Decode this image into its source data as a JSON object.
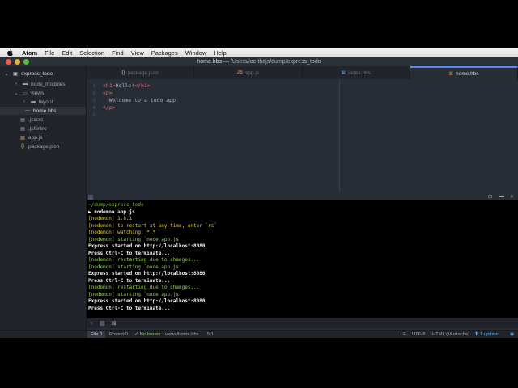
{
  "menubar": {
    "apple": "",
    "items": [
      "Atom",
      "File",
      "Edit",
      "Selection",
      "Find",
      "View",
      "Packages",
      "Window",
      "Help"
    ]
  },
  "window": {
    "title_doc": "home.hbs",
    "title_sep": " — ",
    "title_path": "/Users/ioc-thajs/dump/express_todo"
  },
  "tree": {
    "root": "express_todo",
    "items": [
      {
        "label": "node_modules",
        "icon": "folder-icon",
        "arrow": "›"
      },
      {
        "label": "views",
        "icon": "folder-icon",
        "arrow": "⌄"
      },
      {
        "label": "layout",
        "icon": "folder-icon",
        "arrow": "›"
      },
      {
        "label": "home.hbs",
        "icon": "file-icon"
      },
      {
        "label": ".jscsrc",
        "icon": "file-icon"
      },
      {
        "label": ".jshintrc",
        "icon": "file-icon"
      },
      {
        "label": "app.js",
        "icon": "js-icon"
      },
      {
        "label": "package.json",
        "icon": "json-icon"
      }
    ]
  },
  "tabs": [
    {
      "label": "package.json",
      "icon": "{}"
    },
    {
      "label": "app.js",
      "icon": "JS"
    },
    {
      "label": "index.hbs",
      "icon": "⌘"
    },
    {
      "label": "home.hbs",
      "icon": "⌘",
      "active": true
    }
  ],
  "editor": {
    "lines": [
      {
        "n": "1",
        "open": "<h1>",
        "text": "Hello!",
        "close": "</h1>"
      },
      {
        "n": "2",
        "open": "<p>",
        "text": "",
        "close": ""
      },
      {
        "n": "3",
        "open": "",
        "text": "  Welcome to a todo app",
        "close": ""
      },
      {
        "n": "4",
        "open": "</p>",
        "text": "",
        "close": ""
      },
      {
        "n": "5",
        "open": "",
        "text": "",
        "close": ""
      }
    ]
  },
  "terminal": {
    "lines": [
      {
        "text": "~/dump/express_todo",
        "color": "path"
      },
      {
        "text": "▶ nodemon app.js",
        "color": "white"
      },
      {
        "text": "[nodemon] 1.8.1",
        "color": "yellow"
      },
      {
        "text": "[nodemon] to restart at any time, enter `rs`",
        "color": "yellow"
      },
      {
        "text": "[nodemon] watching: *.*",
        "color": "yellow"
      },
      {
        "text": "[nodemon] starting `node app.js`",
        "color": "green"
      },
      {
        "text": "Express started on http://localhost:8080",
        "color": "white"
      },
      {
        "text": "Press Ctrl-C to terminate...",
        "color": "white"
      },
      {
        "text": "[nodemon] restarting due to changes...",
        "color": "green"
      },
      {
        "text": "[nodemon] starting `node app.js`",
        "color": "green"
      },
      {
        "text": "Express started on http://localhost:8080",
        "color": "white"
      },
      {
        "text": "Press Ctrl-C to terminate...",
        "color": "white"
      },
      {
        "text": "[nodemon] restarting due to changes...",
        "color": "green"
      },
      {
        "text": "[nodemon] starting `node app.js`",
        "color": "green"
      },
      {
        "text": "Express started on http://localhost:8080",
        "color": "white"
      },
      {
        "text": "Press Ctrl-C to terminate...",
        "color": "white"
      }
    ],
    "tools": [
      "+",
      "▤",
      "⊠"
    ]
  },
  "status": {
    "file_tab": "File 0",
    "project_tab": "Project 0",
    "issues": "✓ No Issues",
    "path": "views/home.hbs",
    "cursor": "5:1",
    "line_ending": "LF",
    "encoding": "UTF-8",
    "grammar": "HTML (Mustache)",
    "update": "1 update"
  },
  "colors": {
    "accent": "#568af2",
    "background": "#282c34",
    "panel": "#21252b"
  }
}
